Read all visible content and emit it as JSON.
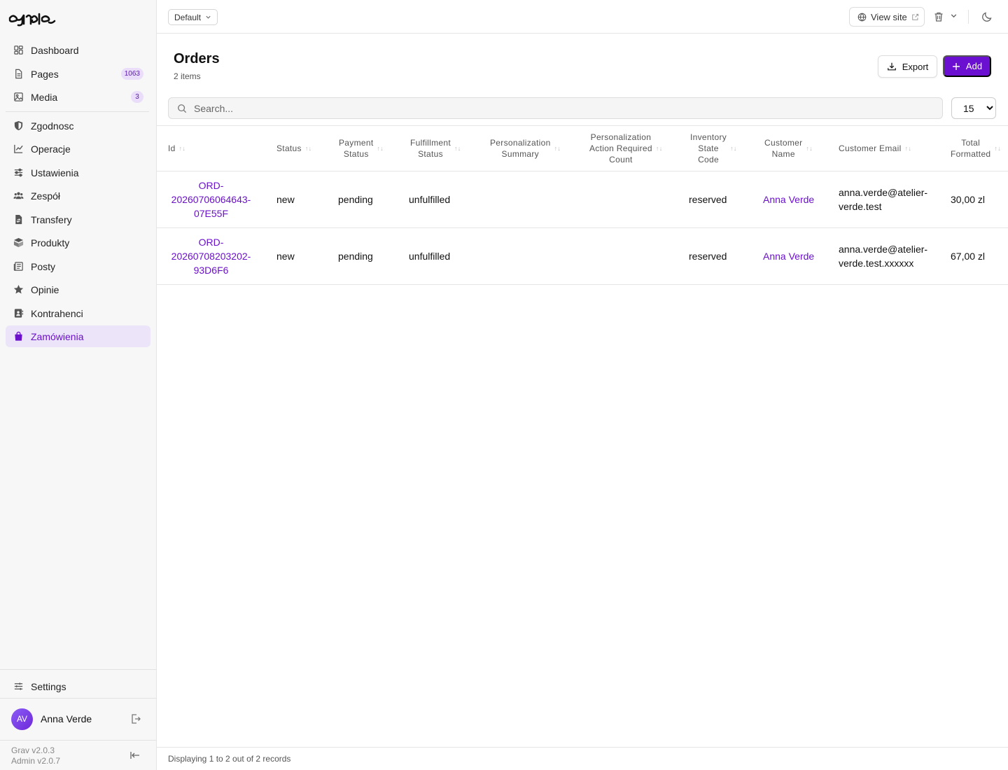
{
  "sidebar": {
    "items": [
      {
        "label": "Dashboard",
        "icon": "dashboard-icon"
      },
      {
        "label": "Pages",
        "icon": "pages-icon",
        "badge": "1063"
      },
      {
        "label": "Media",
        "icon": "media-icon",
        "badge": "3"
      },
      {
        "label": "Zgodnosc",
        "icon": "shield-icon"
      },
      {
        "label": "Operacje",
        "icon": "chart-line-icon"
      },
      {
        "label": "Ustawienia",
        "icon": "sliders-icon"
      },
      {
        "label": "Zespół",
        "icon": "users-icon"
      },
      {
        "label": "Transfery",
        "icon": "file-transfer-icon"
      },
      {
        "label": "Produkty",
        "icon": "box-icon"
      },
      {
        "label": "Posty",
        "icon": "newspaper-icon"
      },
      {
        "label": "Opinie",
        "icon": "star-icon"
      },
      {
        "label": "Kontrahenci",
        "icon": "contact-card-icon"
      },
      {
        "label": "Zamówienia",
        "icon": "shopping-bag-icon",
        "active": true
      }
    ],
    "settings_label": "Settings",
    "user": {
      "initials": "AV",
      "name": "Anna Verde"
    },
    "version_grav": "Grav v2.0.3",
    "version_admin": "Admin v2.0.7"
  },
  "topbar": {
    "environment": "Default",
    "view_site": "View site"
  },
  "main": {
    "title": "Orders",
    "subtitle": "2 items",
    "export_label": "Export",
    "add_label": "Add",
    "search_placeholder": "Search...",
    "per_page": "15"
  },
  "table": {
    "headers": {
      "id": "Id",
      "status": "Status",
      "payment_1": "Payment",
      "payment_2": "Status",
      "fulfillment_1": "Fulfillment",
      "fulfillment_2": "Status",
      "personalization_1": "Personalization",
      "personalization_2": "Summary",
      "action_1": "Personalization",
      "action_2": "Action Required",
      "action_3": "Count",
      "inventory_1": "Inventory",
      "inventory_2": "State",
      "inventory_3": "Code",
      "customer_1": "Customer",
      "customer_2": "Name",
      "email": "Customer Email",
      "total_1": "Total",
      "total_2": "Formatted"
    },
    "rows": [
      {
        "id_1": "ORD-",
        "id_2": "20260706064643-",
        "id_3": "07E55F",
        "status": "new",
        "payment": "pending",
        "fulfillment": "unfulfilled",
        "inventory": "reserved",
        "customer": "Anna Verde",
        "email_1": "anna.verde@atelier-",
        "email_2": "verde.test",
        "total": "30,00 zl"
      },
      {
        "id_1": "ORD-",
        "id_2": "20260708203202-",
        "id_3": "93D6F6",
        "status": "new",
        "payment": "pending",
        "fulfillment": "unfulfilled",
        "inventory": "reserved",
        "customer": "Anna Verde",
        "email_1": "anna.verde@atelier-",
        "email_2": "verde.test.xxxxxx",
        "total": "67,00 zl"
      }
    ],
    "footer": "Displaying 1 to 2 out of 2 records"
  },
  "colors": {
    "accent": "#6b0fd1",
    "active_bg": "#ece4f9"
  }
}
